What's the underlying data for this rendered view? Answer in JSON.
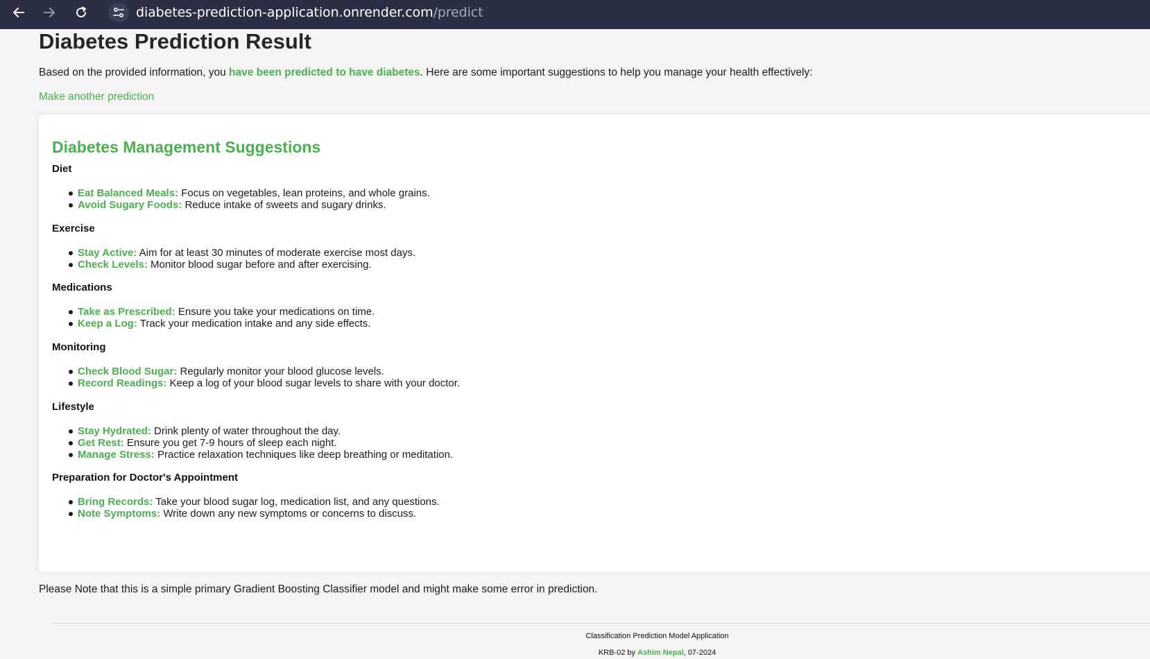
{
  "browser": {
    "url_host": "diabetes-prediction-application.onrender.com",
    "url_path": "/predict"
  },
  "page": {
    "title": "Diabetes Prediction Result",
    "intro_before": "Based on the provided information, you ",
    "intro_highlight": "have been predicted to have diabetes",
    "intro_after": ". Here are some important suggestions to help you manage your health effectively:",
    "another_link": "Make another prediction"
  },
  "suggestions": {
    "heading": "Diabetes Management Suggestions",
    "sections": [
      {
        "title": "Diet",
        "items": [
          {
            "term": "Eat Balanced Meals:",
            "text": " Focus on vegetables, lean proteins, and whole grains."
          },
          {
            "term": "Avoid Sugary Foods:",
            "text": " Reduce intake of sweets and sugary drinks."
          }
        ]
      },
      {
        "title": "Exercise",
        "items": [
          {
            "term": "Stay Active:",
            "text": " Aim for at least 30 minutes of moderate exercise most days."
          },
          {
            "term": "Check Levels:",
            "text": " Monitor blood sugar before and after exercising."
          }
        ]
      },
      {
        "title": "Medications",
        "items": [
          {
            "term": "Take as Prescribed:",
            "text": " Ensure you take your medications on time."
          },
          {
            "term": "Keep a Log:",
            "text": " Track your medication intake and any side effects."
          }
        ]
      },
      {
        "title": "Monitoring",
        "items": [
          {
            "term": "Check Blood Sugar:",
            "text": " Regularly monitor your blood glucose levels."
          },
          {
            "term": "Record Readings:",
            "text": " Keep a log of your blood sugar levels to share with your doctor."
          }
        ]
      },
      {
        "title": "Lifestyle",
        "items": [
          {
            "term": "Stay Hydrated:",
            "text": " Drink plenty of water throughout the day."
          },
          {
            "term": "Get Rest:",
            "text": " Ensure you get 7-9 hours of sleep each night."
          },
          {
            "term": "Manage Stress:",
            "text": " Practice relaxation techniques like deep breathing or meditation."
          }
        ]
      },
      {
        "title": "Preparation for Doctor's Appointment",
        "items": [
          {
            "term": "Bring Records:",
            "text": " Take your blood sugar log, medication list, and any questions."
          },
          {
            "term": "Note Symptoms:",
            "text": " Write down any new symptoms or concerns to discuss."
          }
        ]
      }
    ]
  },
  "note": "Please Note that this is a simple primary Gradient Boosting Classifier model and might make some error in prediction.",
  "footer": {
    "line1": "Classification Prediction Model Application",
    "prefix": "KRB-02 by ",
    "author": "Ashim Nepal",
    "suffix": ", 07-2024"
  },
  "colors": {
    "accent": "#4caf50",
    "browser_bar": "#2b2f45",
    "page_bg": "#f4f4f4"
  },
  "icons": [
    "back-arrow-icon",
    "forward-arrow-icon",
    "reload-icon",
    "site-settings-icon"
  ]
}
